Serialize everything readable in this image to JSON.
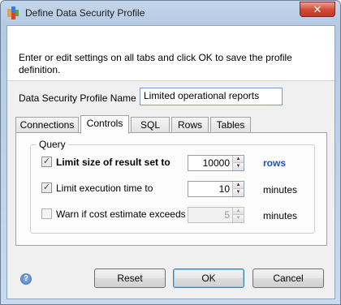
{
  "window": {
    "title": "Define Data Security Profile",
    "close_glyph": "✕"
  },
  "instructions": "Enter or edit settings on all tabs and click OK to save the profile definition.",
  "profile_name": {
    "label": "Data Security Profile Name",
    "value": "Limited operational reports"
  },
  "tabs": [
    {
      "label": "Connections",
      "active": false
    },
    {
      "label": "Controls",
      "active": true
    },
    {
      "label": "SQL",
      "active": false
    },
    {
      "label": "Rows",
      "active": false
    },
    {
      "label": "Tables",
      "active": false
    }
  ],
  "query_group": {
    "title": "Query",
    "rows": [
      {
        "label": "Limit size of result set to",
        "checked": true,
        "value": "10000",
        "unit": "rows",
        "enabled": true
      },
      {
        "label": "Limit execution time to",
        "checked": true,
        "value": "10",
        "unit": "minutes",
        "enabled": true
      },
      {
        "label": "Warn if cost estimate exceeds",
        "checked": false,
        "value": "5",
        "unit": "minutes",
        "enabled": false
      }
    ]
  },
  "buttons": {
    "reset": "Reset",
    "ok": "OK",
    "cancel": "Cancel"
  },
  "icons": {
    "help": "help-icon",
    "check": "✓",
    "spin_up": "▲",
    "spin_down": "▼",
    "help_glyph": "?"
  },
  "colors": {
    "link": "#1d4fc4",
    "titlebar": "#b5cae3",
    "close": "#c33a24"
  }
}
